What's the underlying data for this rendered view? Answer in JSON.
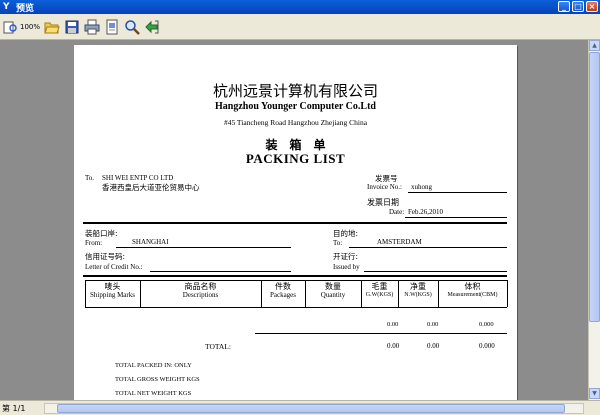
{
  "window": {
    "title": "预览"
  },
  "toolbar": {
    "zoom_label": "100%"
  },
  "status": {
    "page_label": "第 1/1"
  },
  "doc": {
    "company_cn": "杭州远景计算机有限公司",
    "company_en": "Hangzhou Younger Computer Co.Ltd",
    "address": "#45 Tiancheng Road Hangzhou Zhejiang China",
    "title_cn": "装　箱　单",
    "title_en": "PACKING LIST",
    "to_label": "To.",
    "to_name": "SHI WEI ENTP CO LTD",
    "to_name_cn": "香港西皇后大道亚伦贸易中心",
    "invoice_cn": "发票号",
    "invoice_label": "Invoice No.:",
    "invoice_value": "xuhong",
    "date_cn": "发票日期",
    "date_label": "Date:",
    "date_value": "Feb.26,2010",
    "port_load_cn": "装船口岸:",
    "from_label": "From:",
    "from_value": "SHANGHAI",
    "dest_cn": "目的地:",
    "to2_label": "To:",
    "to2_value": "AMSTERDAM",
    "lc_cn": "信用证号码:",
    "lc_label": "Letter of Credit No.:",
    "issuer_cn": "开证行:",
    "issuer_label": "Issued by",
    "columns": [
      {
        "cn": "唛头",
        "en": "Shipping Marks"
      },
      {
        "cn": "商品名称",
        "en": "Descriptions"
      },
      {
        "cn": "件数",
        "en": "Packages"
      },
      {
        "cn": "数量",
        "en": "Quantity"
      },
      {
        "cn": "毛重",
        "en": "G.W(KGS)"
      },
      {
        "cn": "净重",
        "en": "N.W(KGS)"
      },
      {
        "cn": "体积",
        "en": "Measurement(CBM)"
      }
    ],
    "row": {
      "gw": "0.00",
      "nw": "0.00",
      "cbm": "0.000"
    },
    "total_label": "TOTAL:",
    "total": {
      "gw": "0.00",
      "nw": "0.00",
      "cbm": "0.000"
    },
    "packed_in": "TOTAL PACKED IN:   ONLY",
    "gross_weight": "TOTAL GROSS WEIGHT   KGS",
    "net_weight": "TOTAL NET WEIGHT   KGS"
  }
}
